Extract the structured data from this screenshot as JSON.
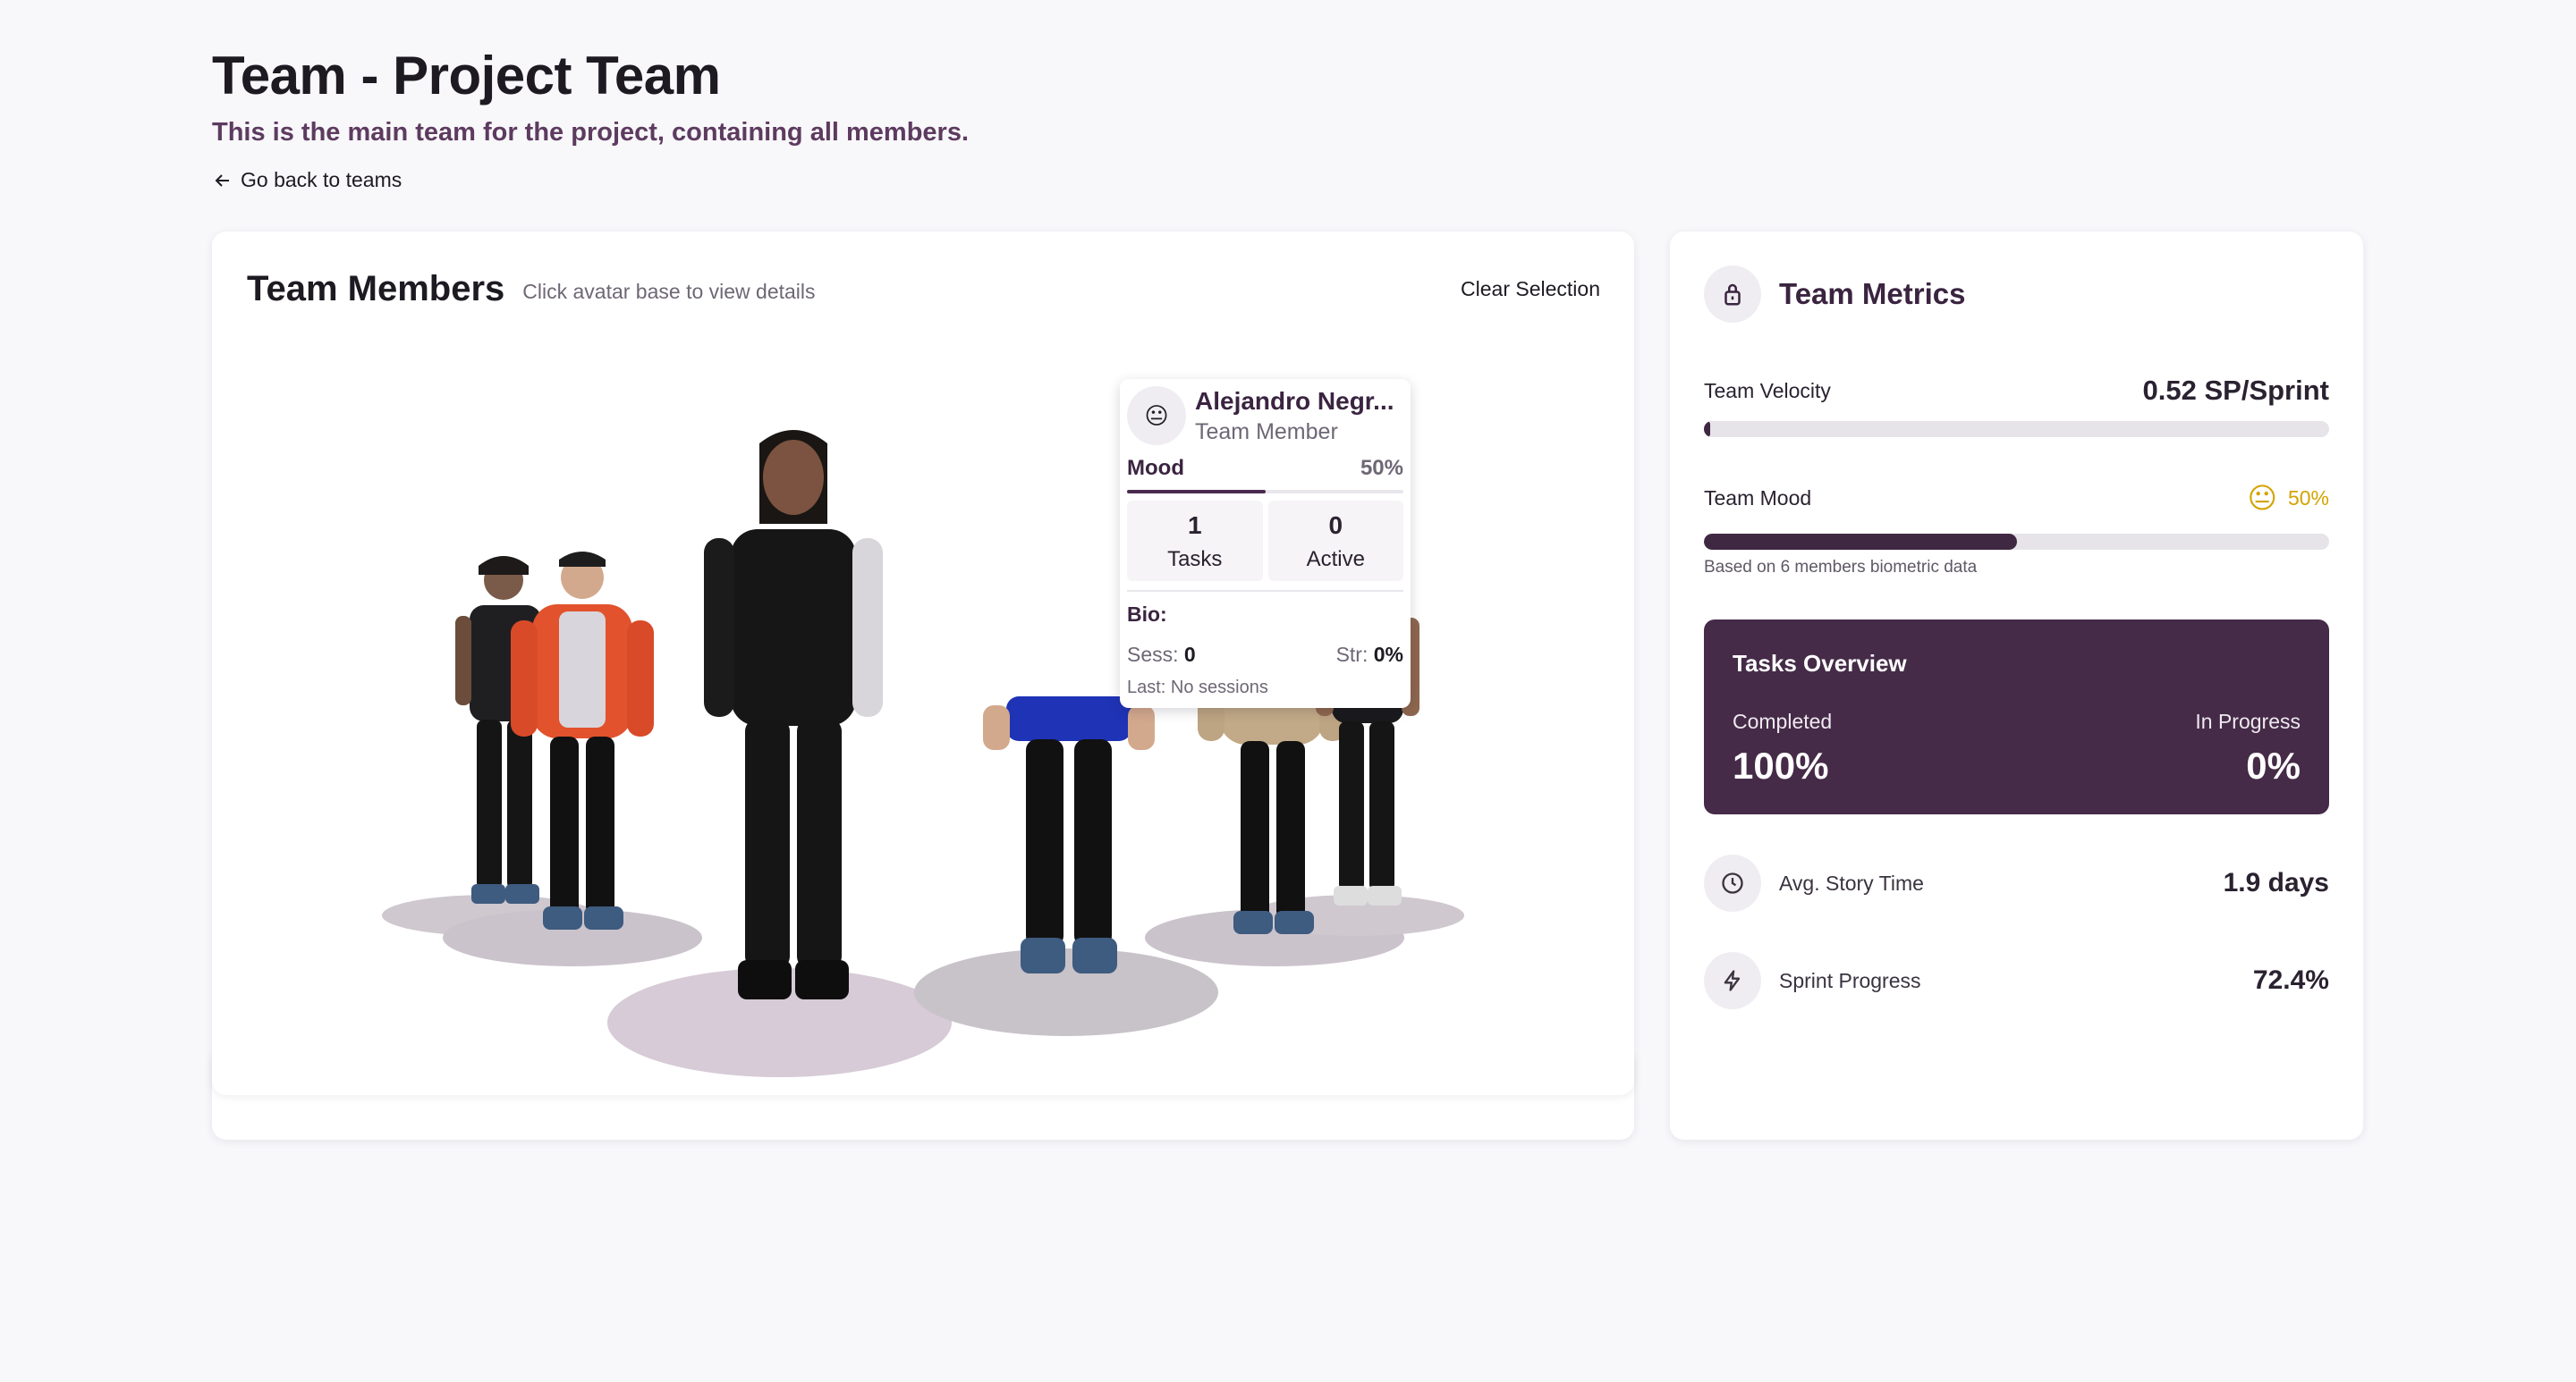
{
  "page": {
    "title": "Team - Project Team",
    "subtitle": "This is the main team for the project, containing all members.",
    "back_link": "Go back to teams"
  },
  "members_panel": {
    "title": "Team Members",
    "hint": "Click avatar base to view details",
    "clear_label": "Clear Selection"
  },
  "member_popup": {
    "emoji": "😐",
    "name": "Alejandro Negr...",
    "role": "Team Member",
    "mood_label": "Mood",
    "mood_value": "50%",
    "mood_fraction": 0.5,
    "tasks_count": "1",
    "tasks_label": "Tasks",
    "active_count": "0",
    "active_label": "Active",
    "bio_title": "Bio:",
    "sess_label": "Sess:",
    "sess_value": "0",
    "str_label": "Str:",
    "str_value": "0%",
    "last_text": "Last: No sessions"
  },
  "metrics": {
    "title": "Team Metrics",
    "velocity_label": "Team Velocity",
    "velocity_value": "0.52 SP/Sprint",
    "velocity_fraction": 0.01,
    "mood_label": "Team Mood",
    "mood_emoji": "😐",
    "mood_value": "50%",
    "mood_fraction": 0.5,
    "mood_note": "Based on 6 members biometric data",
    "tasks_overview": {
      "title": "Tasks Overview",
      "completed_label": "Completed",
      "completed_value": "100%",
      "in_progress_label": "In Progress",
      "in_progress_value": "0%"
    },
    "story_time_label": "Avg. Story Time",
    "story_time_value": "1.9 days",
    "sprint_progress_label": "Sprint Progress",
    "sprint_progress_value": "72.4%"
  },
  "colors": {
    "accent": "#452b48",
    "mood_yellow": "#d3a300",
    "page_bg": "#f8f7fa"
  }
}
